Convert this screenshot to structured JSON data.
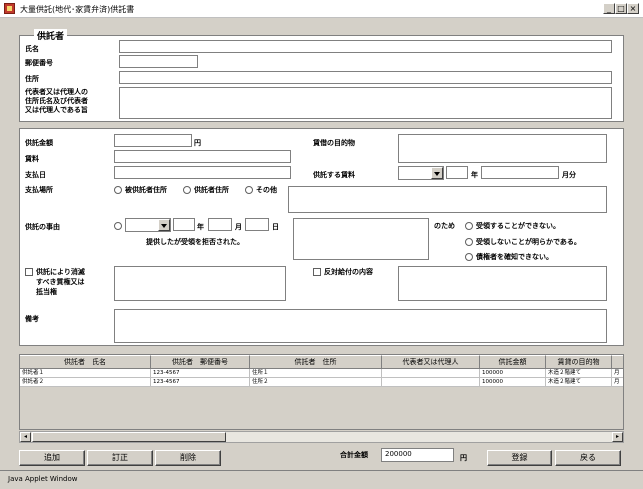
{
  "window": {
    "title": "大量供託(地代･家賃弁済)供託書",
    "minimize": "_",
    "maximize": "□",
    "close": "×"
  },
  "depositor": {
    "legend": "供託者",
    "name_label": "氏名",
    "postal_label": "郵便番号",
    "address_label": "住所",
    "rep_label_1": "代表者又は代理人の",
    "rep_label_2": "住所氏名及び代表者",
    "rep_label_3": "又は代理人である旨"
  },
  "details": {
    "amount_label": "供託金額",
    "amount_unit": "円",
    "rent_label": "賃料",
    "payday_label": "支払日",
    "payplace_label": "支払場所",
    "payplace_options": [
      "被供託者住所",
      "供託者住所",
      "その他"
    ],
    "lease_object_label": "賃借の目的物",
    "rent_period_label": "供託する賃料",
    "year_unit": "年",
    "month_unit": "月分",
    "reason_label": "供託の事由",
    "reason_year": "年",
    "reason_month": "月",
    "reason_day": "日",
    "reason_refused": "提供したが受領を拒否された。",
    "reason_because": "のため",
    "reason_options": [
      "受領することができない。",
      "受領しないことが明らかである。",
      "債権者を確知できない。"
    ],
    "extinguish_label_1": "供託により消滅",
    "extinguish_label_2": "すべき質権又は",
    "extinguish_label_3": "抵当権",
    "counter_label": "反対給付の内容",
    "remarks_label": "備考"
  },
  "table": {
    "columns": [
      "供託者　氏名",
      "供託者　郵便番号",
      "供託者　住所",
      "代表者又は代理人",
      "供託金額",
      "賃貸の目的物"
    ],
    "rows": [
      [
        "供託者１",
        "123-4567",
        "住所１",
        "",
        "100000",
        "木造２階建て",
        "月"
      ],
      [
        "供託者２",
        "123-4567",
        "住所２",
        "",
        "100000",
        "木造２階建て",
        "月"
      ]
    ]
  },
  "scroll": {
    "left": "◂",
    "right": "▸"
  },
  "footer": {
    "add": "追加",
    "edit": "訂正",
    "delete": "削除",
    "total_label": "合計金額",
    "total_value": "200000",
    "total_unit": "円",
    "register": "登録",
    "back": "戻る"
  },
  "status": {
    "text": "Java Applet Window"
  }
}
